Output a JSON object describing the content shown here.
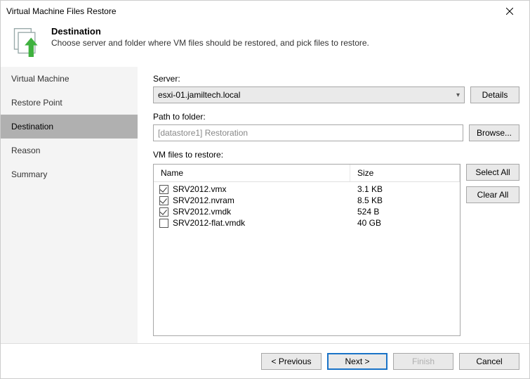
{
  "window_title": "Virtual Machine Files Restore",
  "header": {
    "title": "Destination",
    "description": "Choose server and folder where VM files should be restored, and pick files to restore."
  },
  "sidebar": {
    "items": [
      {
        "label": "Virtual Machine"
      },
      {
        "label": "Restore Point"
      },
      {
        "label": "Destination"
      },
      {
        "label": "Reason"
      },
      {
        "label": "Summary"
      }
    ]
  },
  "main": {
    "server_label": "Server:",
    "server_value": "esxi-01.jamiltech.local",
    "details_label": "Details",
    "path_label": "Path to folder:",
    "path_value": "[datastore1] Restoration",
    "browse_label": "Browse...",
    "files_label": "VM files to restore:",
    "columns": {
      "name": "Name",
      "size": "Size"
    },
    "files": [
      {
        "name": "SRV2012.vmx",
        "size": "3.1 KB",
        "checked": true
      },
      {
        "name": "SRV2012.nvram",
        "size": "8.5 KB",
        "checked": true
      },
      {
        "name": "SRV2012.vmdk",
        "size": "524 B",
        "checked": true
      },
      {
        "name": "SRV2012-flat.vmdk",
        "size": "40 GB",
        "checked": false
      }
    ],
    "select_all_label": "Select All",
    "clear_all_label": "Clear All"
  },
  "footer": {
    "previous": "< Previous",
    "next": "Next >",
    "finish": "Finish",
    "cancel": "Cancel"
  }
}
